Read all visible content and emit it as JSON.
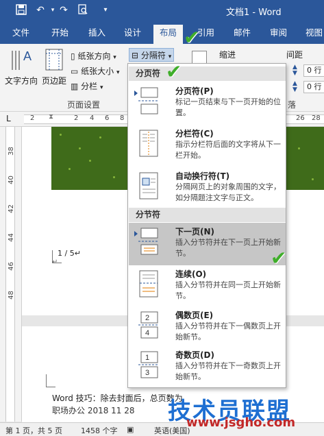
{
  "titlebar": {
    "save_icon": "save-icon",
    "undo_icon": "undo-icon",
    "redo_icon": "redo-icon",
    "preview_icon": "print-preview-icon",
    "customize_icon": "customize-qat-icon",
    "title": "文档1 - Word"
  },
  "tabs": [
    "文件",
    "开始",
    "插入",
    "设计",
    "布局",
    "引用",
    "邮件",
    "审阅",
    "视图"
  ],
  "ribbon": {
    "text_direction": "文字方向",
    "margins": "页边距",
    "orientation": "纸张方向",
    "size": "纸张大小",
    "columns": "分栏",
    "breaks": "分隔符",
    "page_setup_group": "页面设置",
    "indent": "缩进",
    "spacing": "间距",
    "spin1": "0 行",
    "spin2": "0 行",
    "paragraph_group_fragment": "落"
  },
  "ruler": {
    "corner": "L",
    "h_ticks": [
      "2",
      "2",
      "4",
      "6",
      "8",
      "26",
      "28"
    ],
    "v_ticks": [
      "38",
      "40",
      "42",
      "44",
      "46",
      "48"
    ]
  },
  "document": {
    "page_marker": "1 / 5↵",
    "return_mark": "↵",
    "body_line1": "Word 技巧：除去封面后，总页数为",
    "body_line2": "职场办公 2018 11 28"
  },
  "menu": {
    "section_page": "分页符",
    "section_section": "分节符",
    "items": [
      {
        "title": "分页符(P)",
        "desc": "标记一页结束与下一页开始的位置。"
      },
      {
        "title": "分栏符(C)",
        "desc": "指示分栏符后面的文字将从下一栏开始。"
      },
      {
        "title": "自动换行符(T)",
        "desc": "分隔网页上的对象周围的文字，如分隔题注文字与正文。"
      },
      {
        "title": "下一页(N)",
        "desc": "插入分节符并在下一页上开始新节。"
      },
      {
        "title": "连续(O)",
        "desc": "插入分节符并在同一页上开始新节。"
      },
      {
        "title": "偶数页(E)",
        "desc": "插入分节符并在下一偶数页上开始新节。"
      },
      {
        "title": "奇数页(D)",
        "desc": "插入分节符并在下一奇数页上开始新节。"
      }
    ]
  },
  "statusbar": {
    "page": "第 1 页，共 5 页",
    "words": "1458 个字",
    "language": "英语(美国)"
  },
  "watermark": {
    "brand": "技术员联盟",
    "url": "www.jsgho.com"
  },
  "colors": {
    "accent": "#2b579a",
    "check": "#3fae2a",
    "hover": "#c6c6c6"
  }
}
